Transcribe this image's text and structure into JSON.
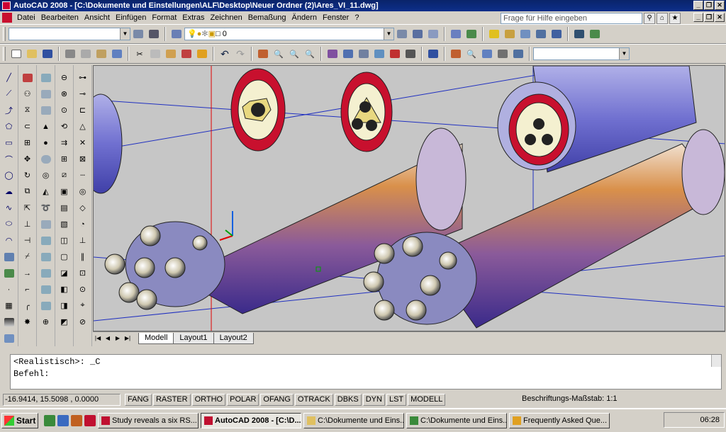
{
  "window": {
    "title": "AutoCAD 2008 - [C:\\Dokumente und Einstellungen\\ALF\\Desktop\\Neuer Ordner (2)\\Ares_VI_11.dwg]"
  },
  "menu": [
    "Datei",
    "Bearbeiten",
    "Ansicht",
    "Einfügen",
    "Format",
    "Extras",
    "Zeichnen",
    "Bemaßung",
    "Ändern",
    "Fenster",
    "?"
  ],
  "help": {
    "placeholder": "Frage für Hilfe eingeben"
  },
  "layer": {
    "current": "0"
  },
  "tabs": {
    "model": "Modell",
    "layout1": "Layout1",
    "layout2": "Layout2"
  },
  "command": {
    "line1": "<Realistisch>: _C",
    "line2": "Befehl:"
  },
  "status": {
    "coords": "-16.9414, 15.5098 , 0.0000",
    "toggles": [
      "FANG",
      "RASTER",
      "ORTHO",
      "POLAR",
      "OFANG",
      "OTRACK",
      "DBKS",
      "DYN",
      "LST",
      "MODELL"
    ],
    "scale_label": "Beschriftungs-Maßstab: 1:1"
  },
  "taskbar": {
    "start": "Start",
    "tasks": [
      {
        "label": "Study reveals a six RS...",
        "active": false
      },
      {
        "label": "AutoCAD 2008 - [C:\\D...",
        "active": true
      },
      {
        "label": "C:\\Dokumente und Eins...",
        "active": false
      },
      {
        "label": "C:\\Dokumente und Eins...",
        "active": false
      },
      {
        "label": "Frequently Asked Que...",
        "active": false
      }
    ],
    "clock": "06:28"
  },
  "colors": {
    "titlebar": "#0a246a",
    "booster": "#d9904a",
    "booster_shade": "#4a3a9a",
    "ring": "#c8102e",
    "axis_red": "#e00000",
    "axis_blue": "#0000e0"
  }
}
